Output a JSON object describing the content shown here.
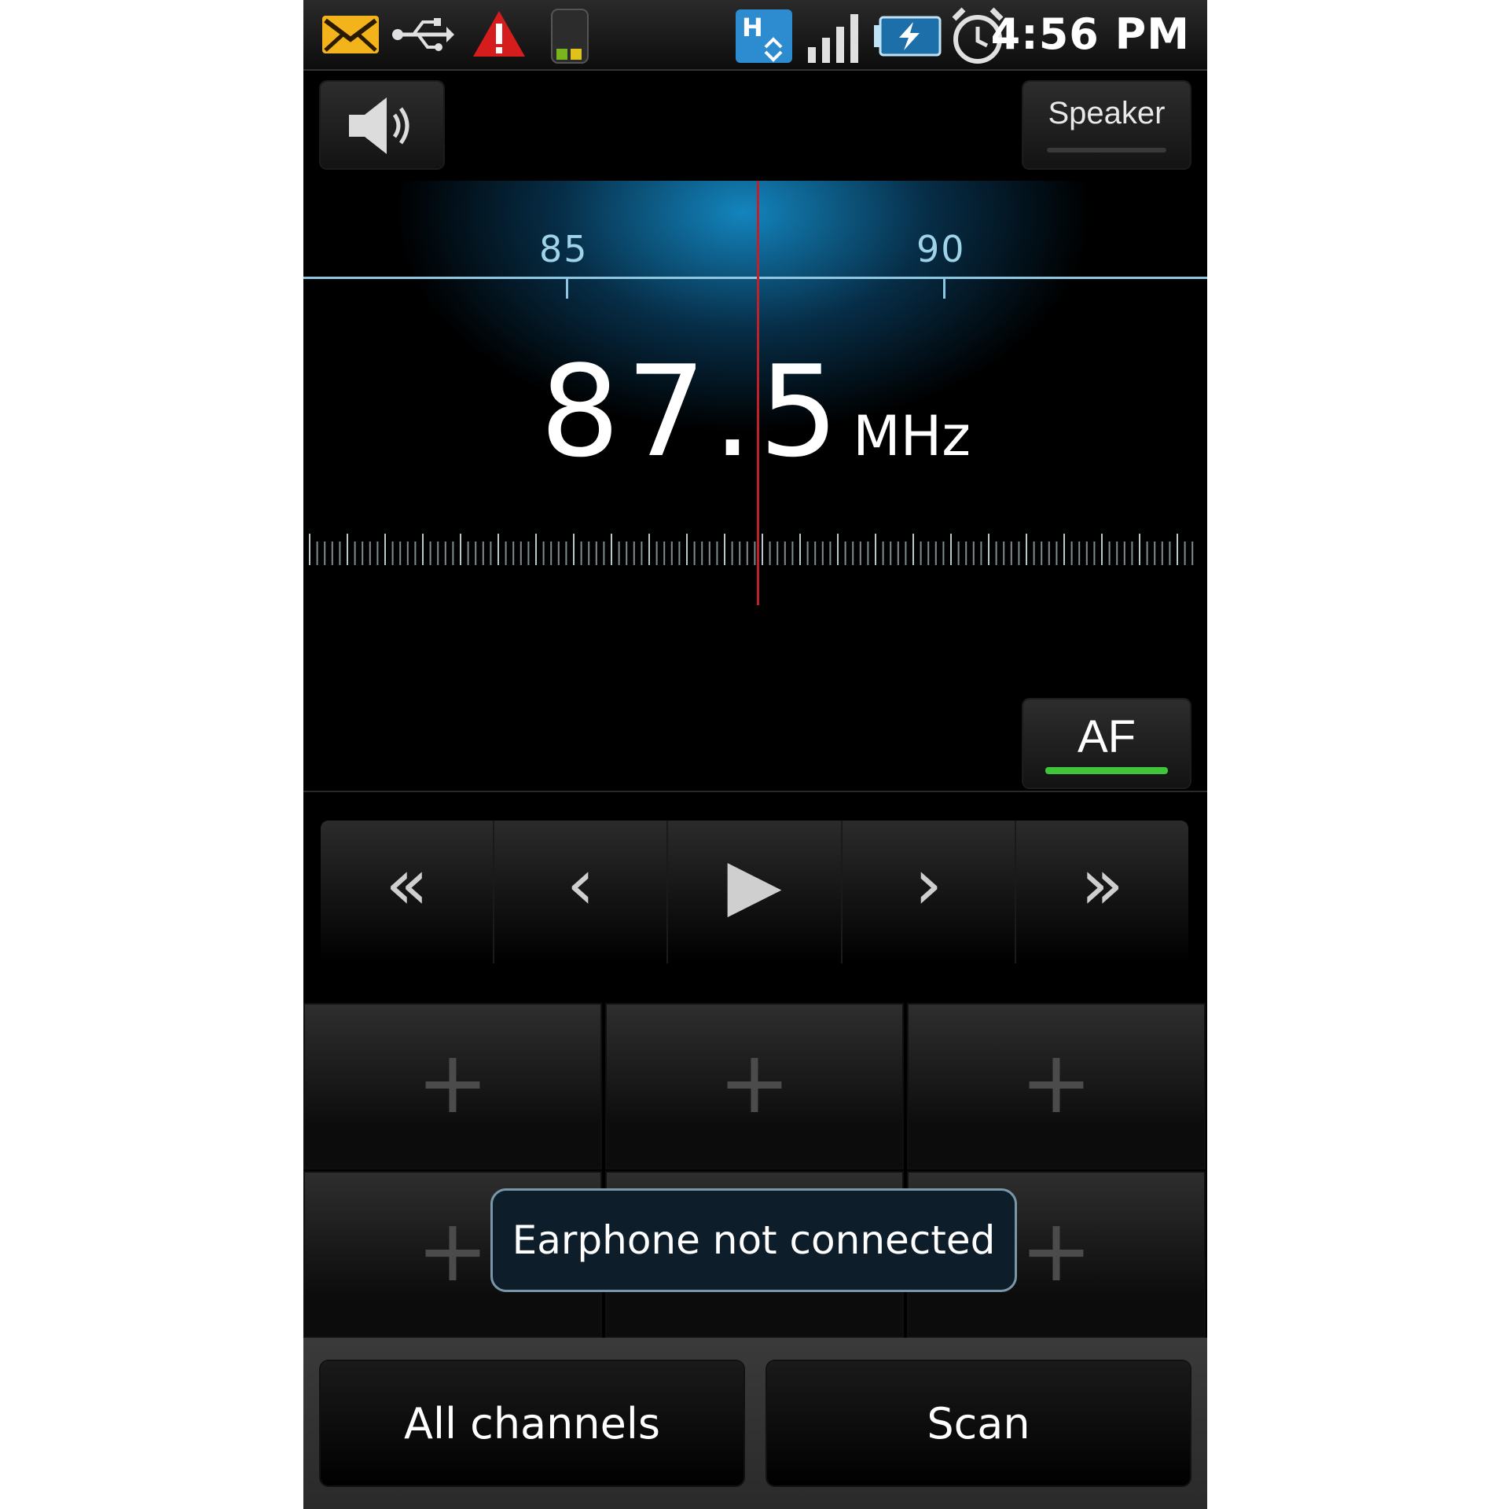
{
  "status_bar": {
    "time": "4:56 PM",
    "icons": [
      "email-icon",
      "usb-icon",
      "warning-icon",
      "sim-icon",
      "hsdpa-icon",
      "signal-icon",
      "battery-charging-icon",
      "alarm-icon"
    ],
    "accent_email": "#f3b31b",
    "accent_warning": "#d61d1d"
  },
  "header": {
    "volume_icon": "speaker-volume-icon",
    "speaker_label": "Speaker"
  },
  "tuner": {
    "scale_labels": [
      "85",
      "90"
    ],
    "frequency": "87.5",
    "unit": "MHz",
    "needle_color": "#c0202a"
  },
  "af": {
    "label": "AF",
    "indicator_color": "#3fc43a"
  },
  "transport": {
    "buttons": [
      {
        "icon": "seek-back-icon",
        "glyph": "«"
      },
      {
        "icon": "step-back-icon",
        "glyph": "‹"
      },
      {
        "icon": "play-icon",
        "glyph": "▶"
      },
      {
        "icon": "step-forward-icon",
        "glyph": "›"
      },
      {
        "icon": "seek-forward-icon",
        "glyph": "»"
      }
    ]
  },
  "presets": {
    "glyph": "+"
  },
  "toast": {
    "message": "Earphone not connected"
  },
  "bottom_bar": {
    "all_channels_label": "All channels",
    "scan_label": "Scan"
  }
}
